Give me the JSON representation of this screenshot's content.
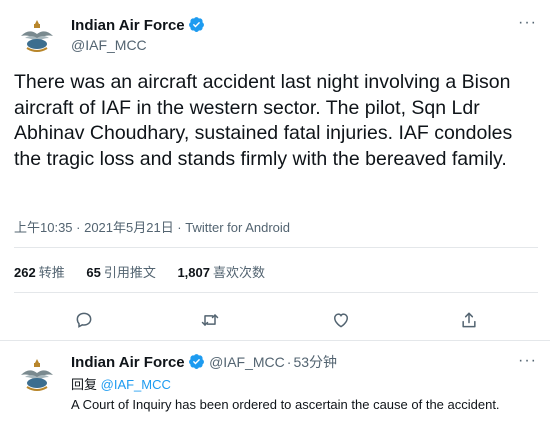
{
  "main_tweet": {
    "author_name": "Indian Air Force",
    "author_handle": "@IAF_MCC",
    "more_label": "···",
    "text": "There was an aircraft accident last night involving a Bison aircraft of IAF in the western sector. The pilot, Sqn Ldr Abhinav Choudhary, sustained fatal injuries. IAF condoles the tragic loss and stands firmly with the bereaved family.",
    "meta": "上午10:35 · 2021年5月21日 · Twitter for Android"
  },
  "stats": {
    "retweets_count": "262",
    "retweets_label": "转推",
    "quotes_count": "65",
    "quotes_label": "引用推文",
    "likes_count": "1,807",
    "likes_label": "喜欢次数"
  },
  "actions": [
    "reply-icon",
    "retweet-icon",
    "like-icon",
    "share-icon"
  ],
  "reply_tweet": {
    "author_name": "Indian Air Force",
    "author_handle": "@IAF_MCC",
    "separator": "·",
    "time": "53分钟",
    "more_label": "···",
    "reply_prefix": "回复",
    "reply_handle": "@IAF_MCC",
    "text": "A Court of Inquiry has been ordered to ascertain the cause of the accident."
  },
  "colors": {
    "verified": "#1d9bf0",
    "text": "#0f1419",
    "secondary": "#536471",
    "divider": "#e4e7ea"
  }
}
